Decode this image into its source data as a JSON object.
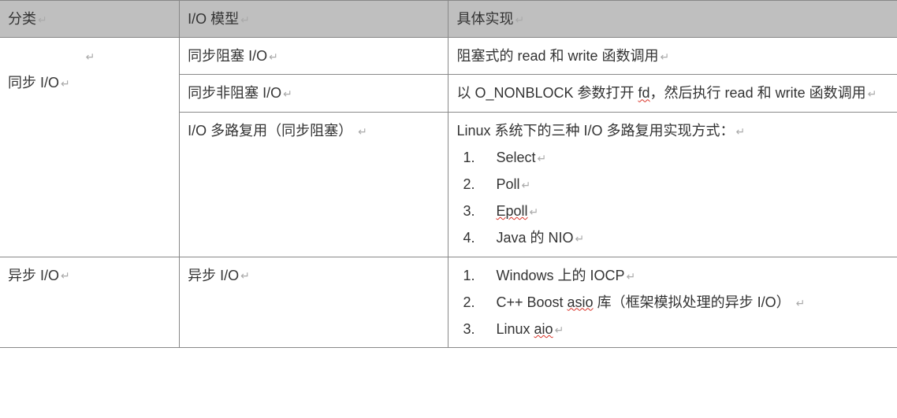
{
  "table": {
    "headers": {
      "col1": "分类",
      "col2": "I/O 模型",
      "col3": "具体实现"
    },
    "returnGlyph": "↵",
    "rows": {
      "sync": {
        "category": "同步 I/O",
        "r1": {
          "model": "同步阻塞 I/O",
          "impl_text": "阻塞式的 read 和 write 函数调用"
        },
        "r2": {
          "model": "同步非阻塞 I/O",
          "impl_prefix": "以 O_NONBLOCK 参数打开 ",
          "impl_fd": "fd",
          "impl_suffix": "，然后执行 read 和 write 函数调用"
        },
        "r3": {
          "model": "I/O 多路复用（同步阻塞）",
          "impl_intro": "Linux 系统下的三种 I/O 多路复用实现方式：",
          "items": [
            {
              "num": "1.",
              "text": "Select"
            },
            {
              "num": "2.",
              "text": "Poll"
            },
            {
              "num": "3.",
              "text_wavy": "Epoll"
            },
            {
              "num": "4.",
              "text": "Java 的 NIO"
            }
          ]
        }
      },
      "async": {
        "category": "异步 I/O",
        "model": "异步 I/O",
        "items": [
          {
            "num": "1.",
            "text": "Windows 上的 IOCP"
          },
          {
            "num": "2.",
            "prefix": "C++ Boost ",
            "wavy": "asio",
            "suffix": " 库（框架模拟处理的异步 I/O）"
          },
          {
            "num": "3.",
            "prefix": "Linux ",
            "wavy": "aio"
          }
        ]
      }
    }
  }
}
